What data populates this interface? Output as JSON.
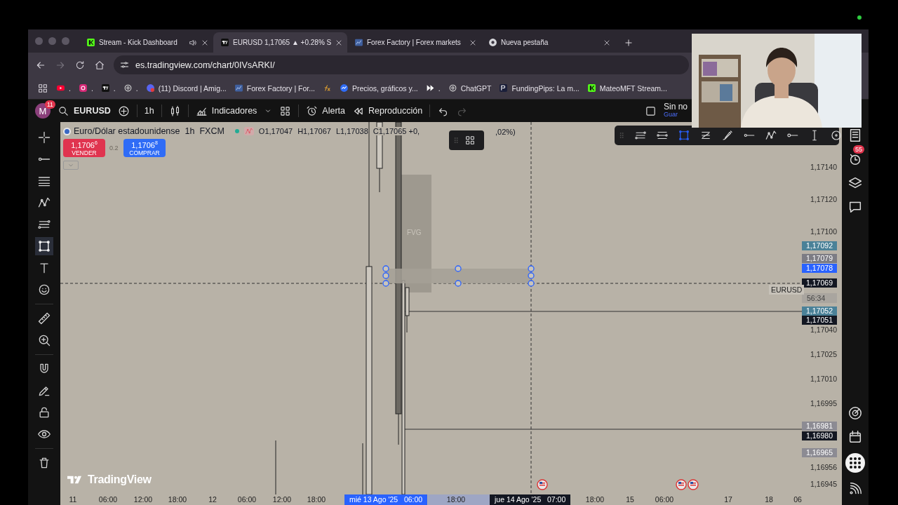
{
  "browser": {
    "tabs": [
      {
        "title": "Stream - Kick Dashboard",
        "kind": "kick",
        "selected": false,
        "audio": true
      },
      {
        "title": "EURUSD 1,17065 ▲ +0.28% S",
        "kind": "tv",
        "selected": true,
        "audio": false
      },
      {
        "title": "Forex Factory | Forex markets",
        "kind": "ff",
        "selected": false,
        "audio": false
      },
      {
        "title": "Nueva pestaña",
        "kind": "chrome",
        "selected": false,
        "audio": false
      }
    ],
    "url": "es.tradingview.com/chart/0IVsARKI/",
    "forward_disabled": true,
    "bookmarks": [
      {
        "label": ".",
        "kind": "youtube"
      },
      {
        "label": ".",
        "kind": "instagram"
      },
      {
        "label": ".",
        "kind": "tv"
      },
      {
        "label": ".",
        "kind": "gpt"
      },
      {
        "label": "(11) Discord | Amig...",
        "kind": "discord"
      },
      {
        "label": "Forex Factory | For...",
        "kind": "ff"
      },
      {
        "kind": "fx"
      },
      {
        "label": "Precios, gráficos y...",
        "kind": "prices"
      },
      {
        "label": ".",
        "kind": "play"
      },
      {
        "label": "ChatGPT",
        "kind": "gpt"
      },
      {
        "label": "FundingPips: La m...",
        "kind": "fp"
      },
      {
        "label": "MateoMFT Stream...",
        "kind": "kick"
      }
    ]
  },
  "toolbar": {
    "avatar": "M",
    "avatar_badge": "11",
    "symbol": "EURUSD",
    "interval": "1h",
    "indicators": "Indicadores",
    "alert": "Alerta",
    "replay": "Reproducción",
    "redo_disabled": true,
    "save_title": "Sin no",
    "save_subtitle": "Guar"
  },
  "left_tools": [
    {
      "kind": "crosshair",
      "selected": false
    },
    {
      "kind": "line",
      "selected": false
    },
    {
      "kind": "fib",
      "selected": false
    },
    {
      "kind": "pattern",
      "selected": false
    },
    {
      "kind": "lines",
      "selected": false
    },
    {
      "kind": "rectangle",
      "selected": true
    },
    {
      "kind": "text",
      "selected": false
    },
    {
      "kind": "smiley",
      "selected": false
    },
    {
      "kind": "ruler",
      "selected": false
    },
    {
      "kind": "zoom",
      "selected": false
    },
    {
      "kind": "magnet",
      "selected": false
    },
    {
      "kind": "pencil",
      "selected": false
    },
    {
      "kind": "lock",
      "selected": false
    },
    {
      "kind": "eye",
      "selected": false
    },
    {
      "kind": "trash",
      "selected": false
    }
  ],
  "legend": {
    "title": "Euro/Dólar estadounidense",
    "interval": "1h",
    "source": "FXCM",
    "ohlc": [
      "O1,17047",
      "H1,17067",
      "L1,17038",
      "C1,17065 +0,"
    ],
    "ohlc_tail": ",02%)",
    "sell": {
      "price": "1,1706$^{6}$",
      "label": "VENDER"
    },
    "spread": "0.2",
    "buy": {
      "price": "1,1706$^{8}$",
      "label": "COMPRAR"
    }
  },
  "drawing_toolbar": [
    {
      "kind": "lines",
      "selected": false
    },
    {
      "kind": "lines2",
      "selected": false
    },
    {
      "kind": "rectangle",
      "selected": true
    },
    {
      "kind": "lines3",
      "selected": false
    },
    {
      "kind": "brush",
      "selected": false
    },
    {
      "kind": "line",
      "selected": false
    },
    {
      "kind": "pattern",
      "selected": false
    },
    {
      "kind": "ray",
      "selected": false
    },
    {
      "kind": "vline",
      "selected": false
    },
    {
      "kind": "circle",
      "selected": false
    }
  ],
  "chart": {
    "zone_label": "FVG",
    "symbol_label": "EURUSD",
    "countdown": "56:34",
    "watermark": "TradingView",
    "price_labels": [
      {
        "text": "1,17140",
        "kind": "plain"
      },
      {
        "text": "1,17120",
        "kind": "plain"
      },
      {
        "text": "1,17100",
        "kind": "plain"
      },
      {
        "text": "1,17092",
        "kind": "tag",
        "color": "#4a8198"
      },
      {
        "text": "1,17079",
        "kind": "tag",
        "color": "#7c7c84"
      },
      {
        "text": "1,17078",
        "kind": "tag",
        "color": "#2962ff"
      },
      {
        "text": "1,17069",
        "kind": "tag",
        "color": "#131722"
      },
      {
        "text": "1,17052",
        "kind": "tag",
        "color": "#4a8198"
      },
      {
        "text": "1,17051",
        "kind": "tag",
        "color": "#131722"
      },
      {
        "text": "1,17040",
        "kind": "plain"
      },
      {
        "text": "1,17025",
        "kind": "plain"
      },
      {
        "text": "1,17010",
        "kind": "plain"
      },
      {
        "text": "1,16995",
        "kind": "plain"
      },
      {
        "text": "1,16981",
        "kind": "tag",
        "color": "#8c8b93"
      },
      {
        "text": "1,16980",
        "kind": "tag",
        "color": "#131722"
      },
      {
        "text": "1,16965",
        "kind": "tag",
        "color": "#8c8b93"
      },
      {
        "text": "1,16956",
        "kind": "plain"
      },
      {
        "text": "1,16945",
        "kind": "plain"
      }
    ],
    "time_labels": [
      {
        "text": "11",
        "kind": "plain"
      },
      {
        "text": "06:00",
        "kind": "plain"
      },
      {
        "text": "12:00",
        "kind": "plain"
      },
      {
        "text": "18:00",
        "kind": "plain"
      },
      {
        "text": "12",
        "kind": "plain"
      },
      {
        "text": "06:00",
        "kind": "plain"
      },
      {
        "text": "12:00",
        "kind": "plain"
      },
      {
        "text": "18:00",
        "kind": "plain"
      },
      {
        "text": "mié 13 Ago '25   06:00",
        "kind": "tag",
        "color": "#2962ff"
      },
      {
        "text": "18:00",
        "kind": "plain"
      },
      {
        "text": "jue 14 Ago '25   07:00",
        "kind": "tag",
        "color": "#131722"
      },
      {
        "text": "18:00",
        "kind": "plain"
      },
      {
        "text": "15",
        "kind": "plain"
      },
      {
        "text": "06:00",
        "kind": "plain"
      },
      {
        "text": "17",
        "kind": "plain"
      },
      {
        "text": "18",
        "kind": "plain"
      },
      {
        "text": "06",
        "kind": "plain"
      }
    ]
  },
  "right_sidebar": [
    {
      "kind": "watchlist"
    },
    {
      "kind": "alerts",
      "badge": "55"
    },
    {
      "kind": "layers"
    },
    {
      "kind": "chat"
    },
    {
      "kind": "spacer"
    },
    {
      "kind": "target"
    },
    {
      "kind": "calendar"
    },
    {
      "kind": "apps"
    },
    {
      "kind": "signal"
    }
  ]
}
